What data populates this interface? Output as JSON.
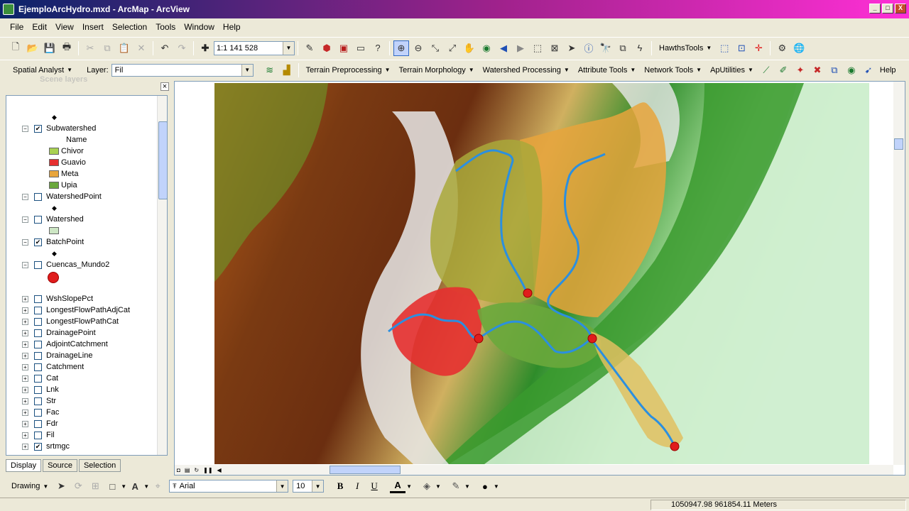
{
  "window": {
    "title": "EjemploArcHydro.mxd - ArcMap - ArcView",
    "min": "_",
    "max": "□",
    "close": "X"
  },
  "menu": [
    "File",
    "Edit",
    "View",
    "Insert",
    "Selection",
    "Tools",
    "Window",
    "Help"
  ],
  "toolbar1": {
    "scale": "1:1 141 528",
    "hawths": "HawthsTools"
  },
  "toolbar2": {
    "spatial_analyst": "Spatial Analyst",
    "layer_label": "Layer:",
    "layer_value": "Fil",
    "menus": [
      "Terrain Preprocessing",
      "Terrain Morphology",
      "Watershed Processing",
      "Attribute Tools",
      "Network Tools",
      "ApUtilities"
    ],
    "help": "Help"
  },
  "toc": {
    "header_ghost": "Scene layers",
    "layers": [
      {
        "label": "Subwatershed",
        "checked": true,
        "expanded": true
      },
      {
        "label": "Name"
      },
      {
        "label": "Chivor",
        "color": "#a9d152"
      },
      {
        "label": "Guavio",
        "color": "#e63030"
      },
      {
        "label": "Meta",
        "color": "#e8a53c"
      },
      {
        "label": "Upia",
        "color": "#6aa83c"
      },
      {
        "label": "WatershedPoint",
        "checked": false,
        "expanded": true
      },
      {
        "label": "Watershed",
        "checked": false,
        "expanded": true
      },
      {
        "label": "BatchPoint",
        "checked": true,
        "expanded": true
      },
      {
        "label": "Cuencas_Mundo2",
        "checked": false,
        "expanded": true
      },
      {
        "label": "WshSlopePct",
        "checked": false
      },
      {
        "label": "LongestFlowPathAdjCat",
        "checked": false
      },
      {
        "label": "LongestFlowPathCat",
        "checked": false
      },
      {
        "label": "DrainagePoint",
        "checked": false
      },
      {
        "label": "AdjointCatchment",
        "checked": false
      },
      {
        "label": "DrainageLine",
        "checked": false
      },
      {
        "label": "Catchment",
        "checked": false
      },
      {
        "label": "Cat",
        "checked": false
      },
      {
        "label": "Lnk",
        "checked": false
      },
      {
        "label": "Str",
        "checked": false
      },
      {
        "label": "Fac",
        "checked": false
      },
      {
        "label": "Fdr",
        "checked": false
      },
      {
        "label": "Fil",
        "checked": false
      },
      {
        "label": "srtmgc",
        "checked": true
      }
    ],
    "tabs": [
      "Display",
      "Source",
      "Selection"
    ]
  },
  "drawing": {
    "label": "Drawing",
    "font": "Arial",
    "size": "10",
    "bold": "B",
    "italic": "I",
    "underline": "U"
  },
  "status": {
    "coords": "1050947.98  961854.11 Meters"
  },
  "colors": {
    "river": "#2b8fe0",
    "outlet": "#e01c1c",
    "chivor": "#a9d152",
    "guavio": "#e63030",
    "meta": "#e8a53c",
    "upia": "#6aa83c"
  }
}
